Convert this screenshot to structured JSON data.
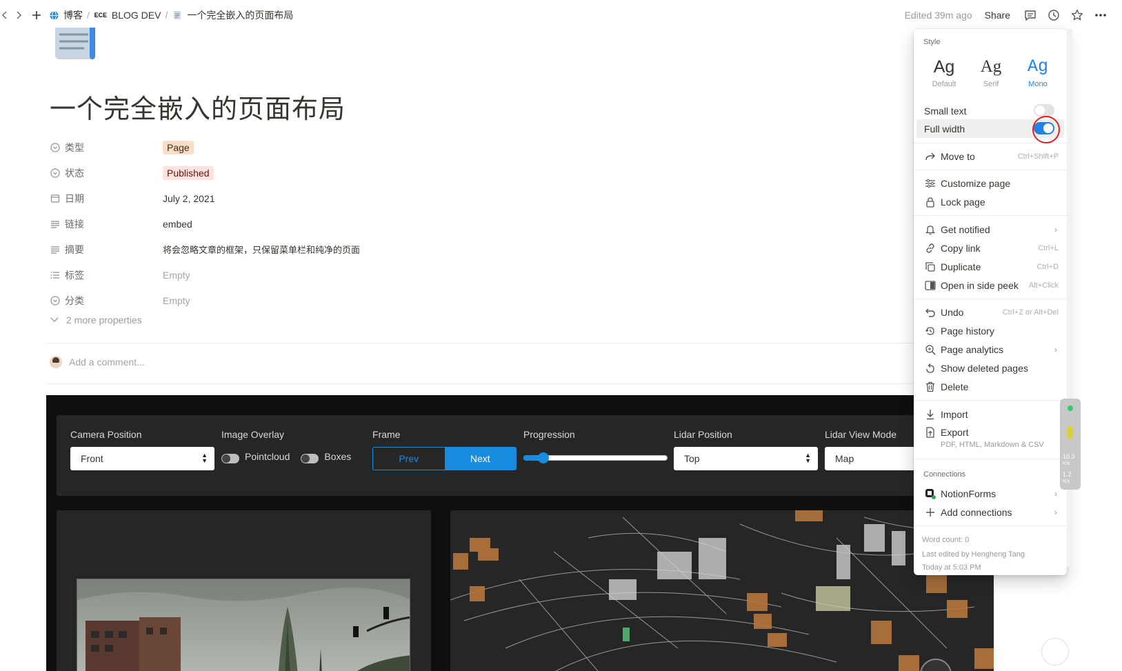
{
  "topbar": {
    "breadcrumbs": [
      {
        "label": "博客",
        "icon": "globe-icon"
      },
      {
        "label": "BLOG DEV",
        "icon": "ece-logo"
      },
      {
        "label": "一个完全嵌入的页面布局",
        "icon": "page-icon"
      }
    ],
    "edited": "Edited 39m ago",
    "share": "Share"
  },
  "page": {
    "title": "一个完全嵌入的页面布局",
    "properties": [
      {
        "name": "类型",
        "icon": "select-icon",
        "value": "Page",
        "kind": "tag-page"
      },
      {
        "name": "状态",
        "icon": "select-icon",
        "value": "Published",
        "kind": "tag-pub"
      },
      {
        "name": "日期",
        "icon": "calendar-icon",
        "value": "July 2, 2021",
        "kind": "text"
      },
      {
        "name": "链接",
        "icon": "text-icon",
        "value": "embed",
        "kind": "text"
      },
      {
        "name": "摘要",
        "icon": "text-icon",
        "value": "将会忽略文章的框架，只保留菜单栏和纯净的页面",
        "kind": "text"
      },
      {
        "name": "标签",
        "icon": "list-icon",
        "value": "Empty",
        "kind": "empty"
      },
      {
        "name": "分类",
        "icon": "select-icon",
        "value": "Empty",
        "kind": "empty"
      }
    ],
    "more_properties": "2 more properties",
    "comment_placeholder": "Add a comment..."
  },
  "embed": {
    "camera_position": {
      "label": "Camera Position",
      "value": "Front"
    },
    "image_overlay": {
      "label": "Image Overlay",
      "options": [
        "Pointcloud",
        "Boxes"
      ]
    },
    "frame": {
      "label": "Frame",
      "prev": "Prev",
      "next": "Next"
    },
    "progression": {
      "label": "Progression",
      "value": 0.1
    },
    "lidar_position": {
      "label": "Lidar Position",
      "value": "Top"
    },
    "lidar_view_mode": {
      "label": "Lidar View Mode",
      "value": "Map"
    }
  },
  "menu": {
    "style_label": "Style",
    "styles": [
      {
        "ag": "Ag",
        "name": "Default"
      },
      {
        "ag": "Ag",
        "name": "Serif"
      },
      {
        "ag": "Ag",
        "name": "Mono"
      }
    ],
    "small_text": "Small text",
    "full_width": "Full width",
    "move_to": {
      "label": "Move to",
      "shortcut": "Ctrl+Shift+P"
    },
    "customize_page": "Customize page",
    "lock_page": "Lock page",
    "get_notified": "Get notified",
    "copy_link": {
      "label": "Copy link",
      "shortcut": "Ctrl+L"
    },
    "duplicate": {
      "label": "Duplicate",
      "shortcut": "Ctrl+D"
    },
    "open_side_peek": {
      "label": "Open in side peek",
      "shortcut": "Alt+Click"
    },
    "undo": {
      "label": "Undo",
      "shortcut": "Ctrl+Z or Alt+Del"
    },
    "page_history": "Page history",
    "page_analytics": "Page analytics",
    "show_deleted": "Show deleted pages",
    "delete": "Delete",
    "import": "Import",
    "export": {
      "label": "Export",
      "sub": "PDF, HTML, Markdown & CSV"
    },
    "connections_label": "Connections",
    "notionforms": "NotionForms",
    "add_connections": "Add connections",
    "word_count": "Word count: 0",
    "last_edited_by": "Last edited by Hengheng Tang",
    "last_edited_time": "Today at 5:03 PM"
  },
  "net_widget": {
    "down": "10.3",
    "down_unit": "K/s",
    "up": "1.2",
    "up_unit": "K/s"
  }
}
